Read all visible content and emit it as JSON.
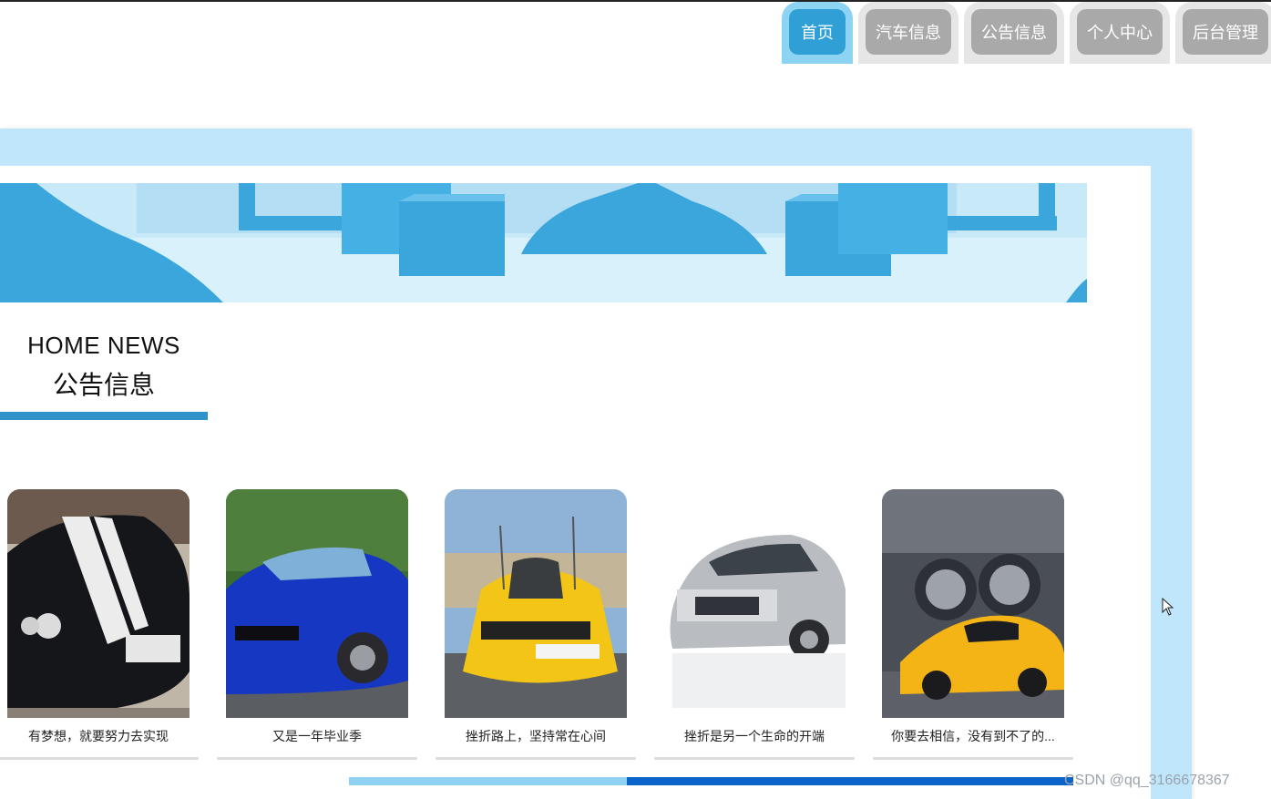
{
  "nav": {
    "tabs": [
      {
        "label": "首页",
        "active": true
      },
      {
        "label": "汽车信息",
        "active": false
      },
      {
        "label": "公告信息",
        "active": false
      },
      {
        "label": "个人中心",
        "active": false
      },
      {
        "label": "后台管理",
        "active": false
      }
    ]
  },
  "section": {
    "title_en": "HOME NEWS",
    "title_cn": "公告信息"
  },
  "cards": [
    {
      "caption": "有梦想，就要努力去实现"
    },
    {
      "caption": "又是一年毕业季"
    },
    {
      "caption": "挫折路上，坚持常在心间"
    },
    {
      "caption": "挫折是另一个生命的开端"
    },
    {
      "caption": "你要去相信，没有到不了的..."
    }
  ],
  "carousel": {
    "progress_fraction": 0.62
  },
  "watermark": "CSDN @qq_3166678367",
  "colors": {
    "accent": "#2f9fd6",
    "frame": "#bfe6fa",
    "progress_track": "#8fd2f3",
    "progress_fill": "#0a63c8"
  }
}
